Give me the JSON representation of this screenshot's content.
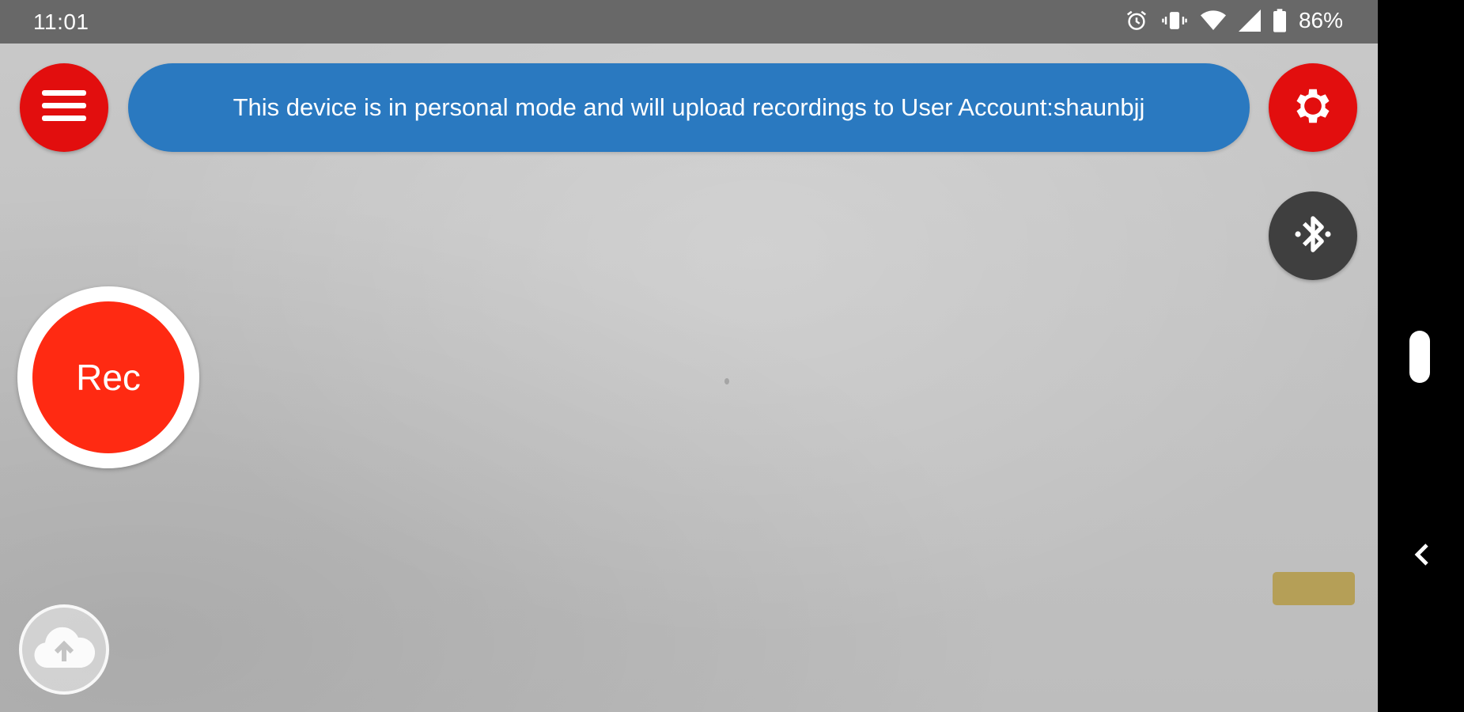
{
  "status_bar": {
    "time": "11:01",
    "battery": "86%",
    "icons": [
      "alarm-icon",
      "vibrate-icon",
      "wifi-icon",
      "cell-signal-icon",
      "battery-icon"
    ]
  },
  "toolbar": {
    "menu_icon": "hamburger-menu-icon",
    "settings_icon": "gear-icon",
    "bluetooth_icon": "bluetooth-icon"
  },
  "banner": {
    "text": "This device is in personal mode and will upload recordings to User Account:shaunbjj"
  },
  "record": {
    "label": "Rec"
  },
  "upload": {
    "icon": "cloud-upload-icon"
  },
  "colors": {
    "red": "#e20e0e",
    "rec_red": "#ff2a12",
    "banner_blue": "#2a79c0",
    "dark_grey": "#3f3f3f",
    "gold": "#b59f57"
  }
}
